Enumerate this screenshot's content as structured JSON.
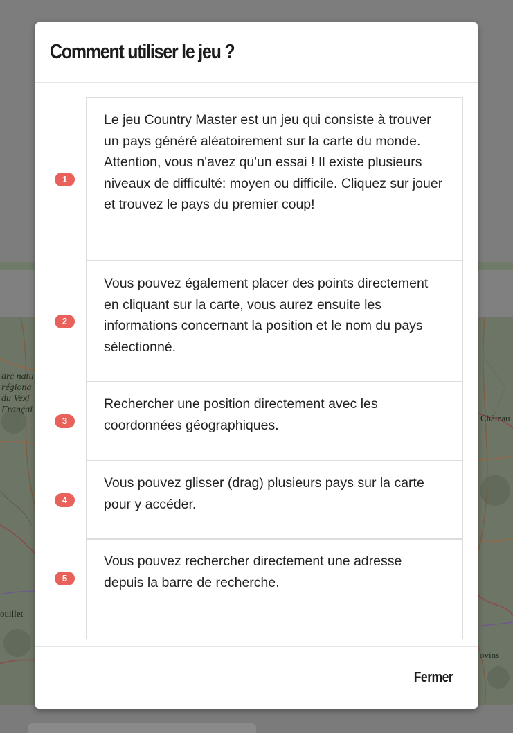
{
  "modal": {
    "title": "Comment utiliser le jeu ?",
    "close_label": "Fermer",
    "badge_color": "#e8615a",
    "steps": [
      {
        "number": "1",
        "text": "Le jeu Country Master est un jeu qui consiste à trouver un pays généré aléatoirement sur la carte du monde. Attention, vous n'avez qu'un essai ! Il existe plusieurs niveaux de difficulté: moyen ou difficile. Cliquez sur jouer et trouvez le pays du premier coup!"
      },
      {
        "number": "2",
        "text": "Vous pouvez également placer des points directement en cliquant sur la carte, vous aurez ensuite les informations concernant la position et le nom du pays sélectionné."
      },
      {
        "number": "3",
        "text": "Rechercher une position directement avec les coordonnées géographiques."
      },
      {
        "number": "4",
        "text": "Vous pouvez glisser (drag) plusieurs pays sur la carte pour y accéder."
      },
      {
        "number": "5",
        "text": "Vous pouvez rechercher directement une adresse depuis la barre de recherche."
      }
    ]
  },
  "map": {
    "labels": {
      "park_line1": "arc natu",
      "park_line2": "régiona",
      "park_line3": "du Vexi",
      "park_line4": "Françai",
      "chateau": "Château",
      "rambouillet": "ouillet",
      "provins": "ovins"
    }
  }
}
